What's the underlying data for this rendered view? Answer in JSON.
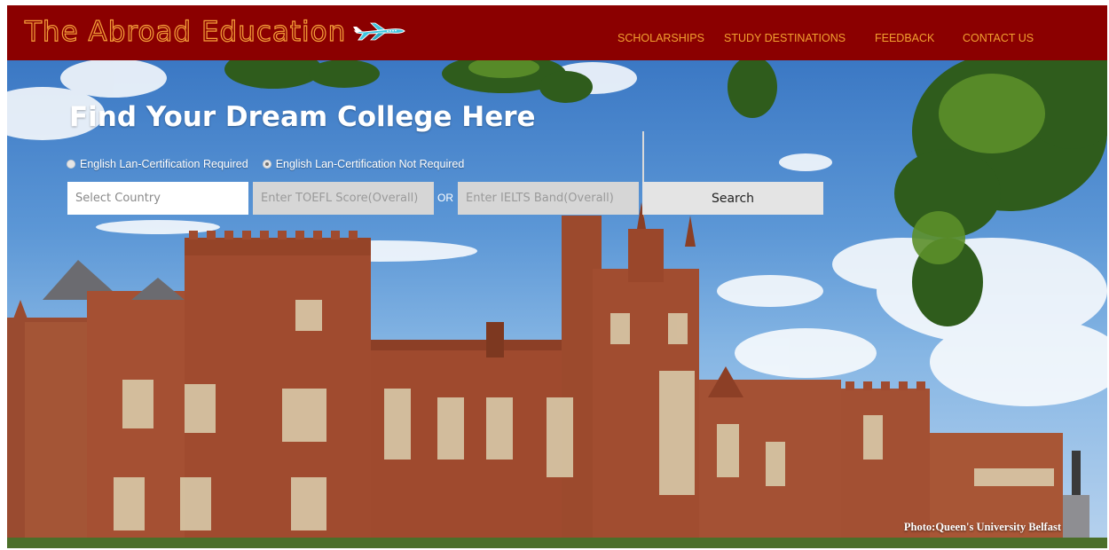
{
  "brand": {
    "name": "The Abroad Education",
    "text_color": "#f6a03a",
    "icon": "airplane-icon"
  },
  "nav": {
    "background": "#8b0000",
    "link_color": "#f2a030",
    "items": [
      {
        "label": "SCHOLARSHIPS"
      },
      {
        "label": "STUDY DESTINATIONS"
      },
      {
        "label": "FEEDBACK"
      },
      {
        "label": "CONTACT US"
      }
    ]
  },
  "hero": {
    "title": "Find Your Dream College Here",
    "radio_options": [
      {
        "label": "English Lan-Certification Required",
        "checked": false
      },
      {
        "label": "English Lan-Certification Not Required",
        "checked": true
      }
    ],
    "search": {
      "country_placeholder": "Select Country",
      "toefl_placeholder": "Enter TOEFL Score(Overall)",
      "or_label": "OR",
      "ielts_placeholder": "Enter IELTS Band(Overall)",
      "button_label": "Search"
    },
    "photo_credit": "Photo:Queen's University Belfast"
  }
}
